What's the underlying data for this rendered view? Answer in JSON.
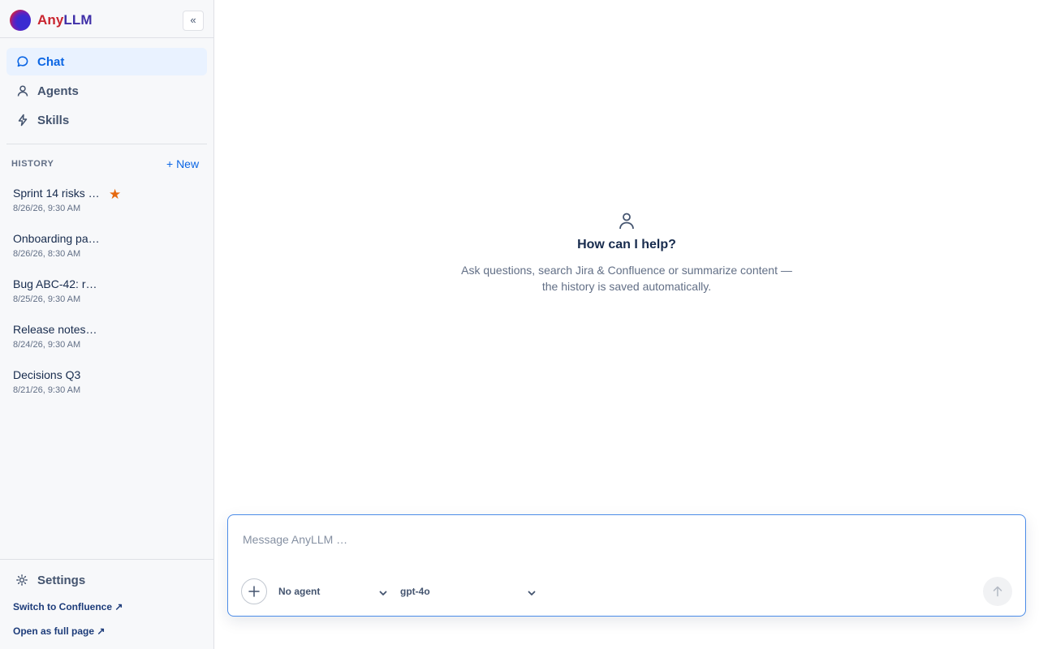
{
  "brand": {
    "name_part1": "Any",
    "name_part2": "LLM",
    "collapse_label": "«"
  },
  "nav": [
    {
      "label": "Chat",
      "icon": "chat-bubble-icon",
      "active": true
    },
    {
      "label": "Agents",
      "icon": "person-icon",
      "active": false
    },
    {
      "label": "Skills",
      "icon": "lightning-icon",
      "active": false
    }
  ],
  "history": {
    "title": "HISTORY",
    "new_label": "+ New",
    "items": [
      {
        "title": "Sprint 14 risks …",
        "date": "8/26/26, 9:30 AM",
        "starred": true
      },
      {
        "title": "Onboarding pa…",
        "date": "8/26/26, 8:30 AM",
        "starred": false
      },
      {
        "title": "Bug ABC-42: r…",
        "date": "8/25/26, 9:30 AM",
        "starred": false
      },
      {
        "title": "Release notes…",
        "date": "8/24/26, 9:30 AM",
        "starred": false
      },
      {
        "title": "Decisions Q3",
        "date": "8/21/26, 9:30 AM",
        "starred": false
      }
    ]
  },
  "footer": {
    "settings_label": "Settings",
    "switch_link": "Switch to Confluence ↗",
    "full_page_link": "Open as full page ↗"
  },
  "empty_state": {
    "icon": "person-icon",
    "title": "How can I help?",
    "subtitle": "Ask questions, search Jira & Confluence or summarize content — the history is saved automatically."
  },
  "composer": {
    "placeholder": "Message AnyLLM …",
    "value": "",
    "agent_select": "No agent",
    "model_select": "gpt-4o"
  },
  "colors": {
    "accent": "#0c66e4",
    "star": "#e56910",
    "active_bg": "#e9f2ff"
  }
}
